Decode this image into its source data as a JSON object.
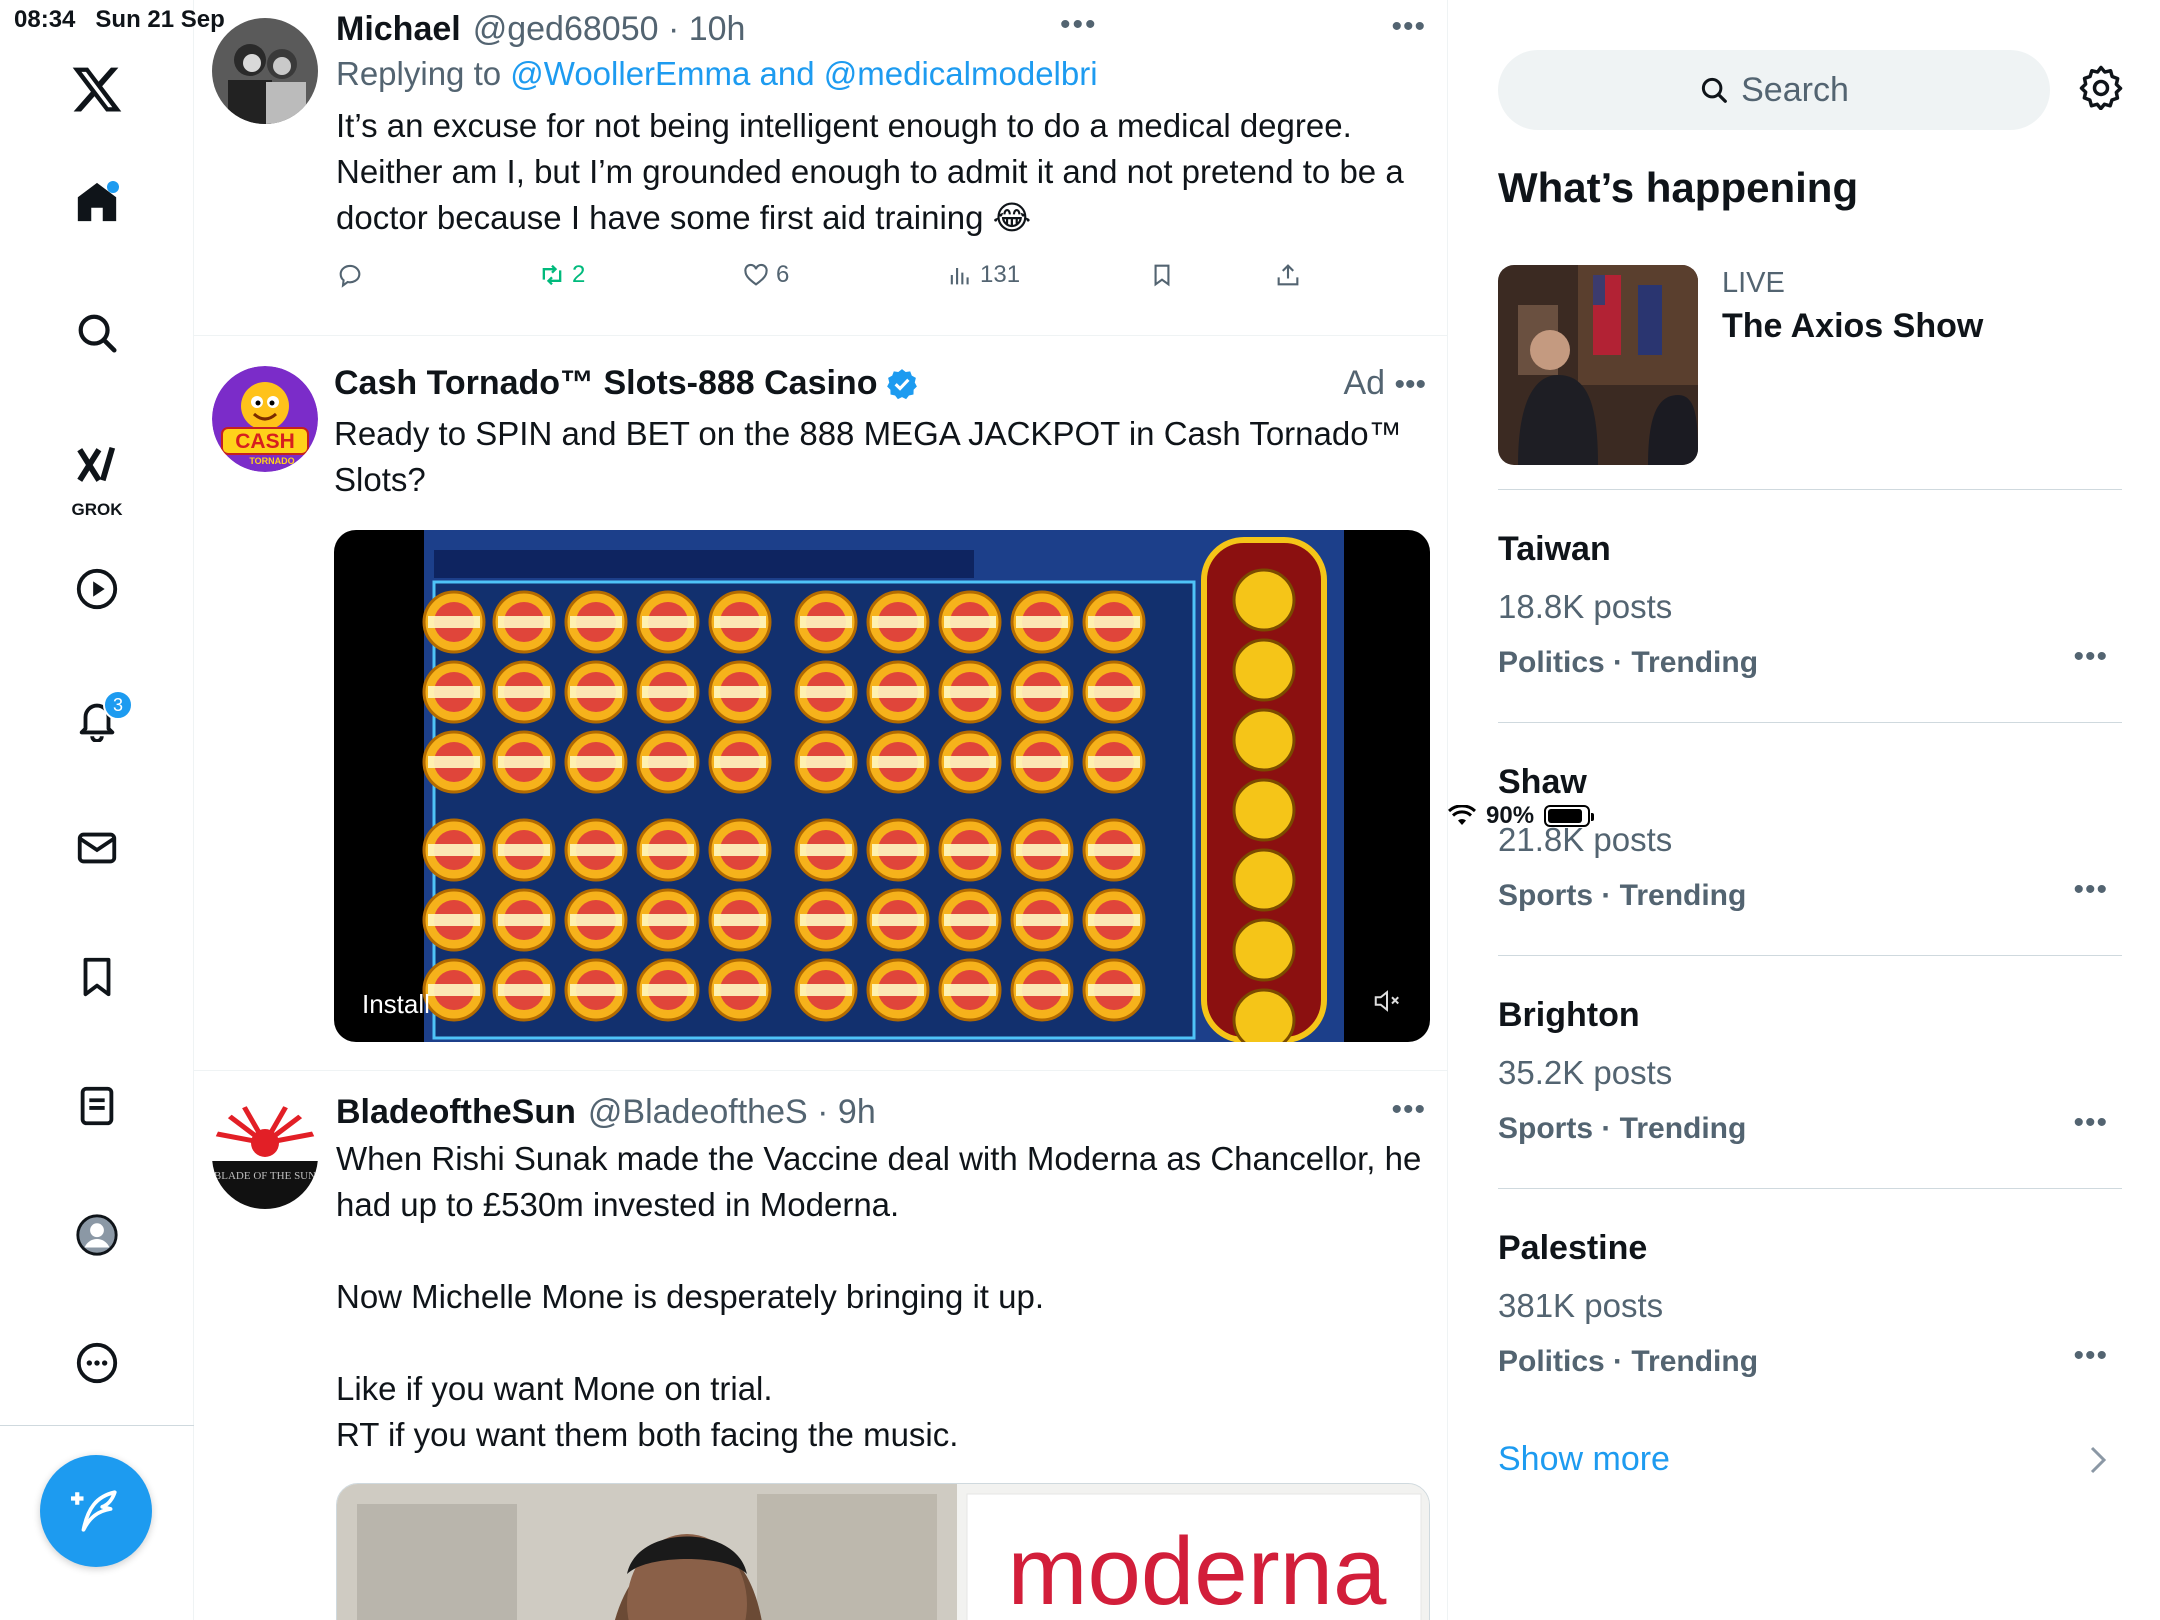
{
  "status_bar": {
    "time": "08:34",
    "date": "Sun 21 Sep",
    "battery": "90%",
    "battery_level": 0.9
  },
  "nav": {
    "items": [
      {
        "name": "x-logo",
        "icon": "x-logo-icon"
      },
      {
        "name": "home",
        "icon": "home-icon",
        "has_dot": true
      },
      {
        "name": "explore",
        "icon": "search-icon"
      },
      {
        "name": "grok",
        "icon": "grok-icon",
        "label": "GROK"
      },
      {
        "name": "videos",
        "icon": "play-icon"
      },
      {
        "name": "notifications",
        "icon": "bell-icon",
        "badge": "3"
      },
      {
        "name": "messages",
        "icon": "mail-icon"
      },
      {
        "name": "bookmarks",
        "icon": "bookmark-icon"
      },
      {
        "name": "lists",
        "icon": "list-icon"
      },
      {
        "name": "profile",
        "icon": "profile-icon"
      },
      {
        "name": "more",
        "icon": "more-icon"
      }
    ],
    "compose_icon": "compose-icon"
  },
  "feed": {
    "tweets": [
      {
        "name": "Michael",
        "handle": "@ged68050",
        "time": "10h",
        "replying_prefix": "Replying to",
        "replying_to": "@WoollerEmma and @medicalmodelbri",
        "text": "It’s an excuse for not being intelligent enough to do a medical degree. Neither am I, but I’m grounded enough to admit it and not pretend to be a doctor because I have some first aid training 😂",
        "reposts": "2",
        "likes": "6",
        "views": "131"
      },
      {
        "name": "Cash Tornado™ Slots-888 Casino",
        "ad_label": "Ad",
        "text": "Ready to SPIN and BET on the 888 MEGA JACKPOT in Cash Tornado™ Slots?",
        "media_cta": "Install",
        "avatar_text": "CASH",
        "avatar_subtext": "TORNADO"
      },
      {
        "name": "BladeoftheSun",
        "handle": "@BladeoftheS",
        "time": "9h",
        "text": "When Rishi Sunak made the Vaccine deal with Moderna as Chancellor, he had up to £530m invested in Moderna.\n\nNow Michelle Mone is desperately bringing it up.\n\nLike if you want Mone on trial.\nRT if you want them both facing the music.",
        "media_text": "moderna",
        "avatar_text": "BLADE OF THE SUN"
      }
    ]
  },
  "sidebar": {
    "search_placeholder": "Search",
    "section_title": "What’s happening",
    "live": {
      "label": "LIVE",
      "title": "The Axios Show"
    },
    "trends": [
      {
        "name": "Taiwan",
        "posts": "18.8K posts",
        "category": "Politics · Trending"
      },
      {
        "name": "Shaw",
        "posts": "21.8K posts",
        "category": "Sports · Trending"
      },
      {
        "name": "Brighton",
        "posts": "35.2K posts",
        "category": "Sports · Trending"
      },
      {
        "name": "Palestine",
        "posts": "381K posts",
        "category": "Politics · Trending"
      }
    ],
    "show_more": "Show more"
  },
  "colors": {
    "accent": "#1d9bf0",
    "secondary_text": "#536471",
    "repost_green": "#00ba7c"
  }
}
